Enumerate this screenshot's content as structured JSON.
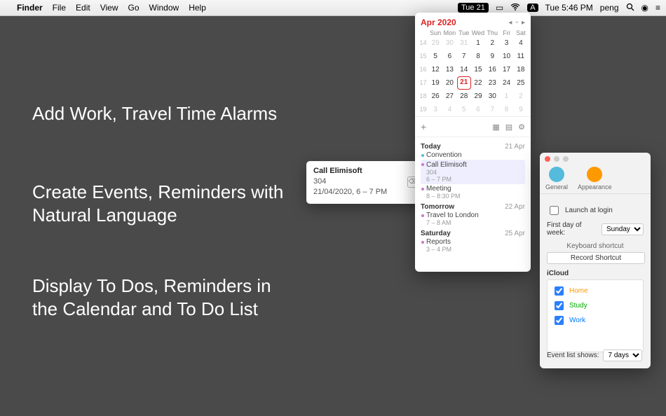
{
  "menubar": {
    "app": "Finder",
    "items": [
      "File",
      "Edit",
      "View",
      "Go",
      "Window",
      "Help"
    ],
    "date_badge": "Tue 21",
    "a_icon": "A",
    "clock": "Tue 5:46 PM",
    "user": "peng"
  },
  "marketing": {
    "l1": "Add Work, Travel Time Alarms",
    "l2": "Create Events, Reminders with Natural Language",
    "l3": "Display To Dos, Reminders in the Calendar and To Do List"
  },
  "quickadd": {
    "title": "Call Elimisoft",
    "room": "304",
    "when": "21/04/2020, 6 – 7 PM"
  },
  "cal": {
    "month": "Apr 2020",
    "wdays": [
      "Sun",
      "Mon",
      "Tue",
      "Wed",
      "Thu",
      "Fri",
      "Sat"
    ],
    "weeks": [
      {
        "wn": "14",
        "d": [
          "29",
          "30",
          "31",
          "1",
          "2",
          "3",
          "4"
        ],
        "dim": [
          0,
          1,
          2
        ]
      },
      {
        "wn": "15",
        "d": [
          "5",
          "6",
          "7",
          "8",
          "9",
          "10",
          "11"
        ],
        "dim": []
      },
      {
        "wn": "16",
        "d": [
          "12",
          "13",
          "14",
          "15",
          "16",
          "17",
          "18"
        ],
        "dim": []
      },
      {
        "wn": "17",
        "d": [
          "19",
          "20",
          "21",
          "22",
          "23",
          "24",
          "25"
        ],
        "dim": [],
        "today": 2
      },
      {
        "wn": "18",
        "d": [
          "26",
          "27",
          "28",
          "29",
          "30",
          "1",
          "2"
        ],
        "dim": [
          5,
          6
        ]
      },
      {
        "wn": "19",
        "d": [
          "3",
          "4",
          "5",
          "6",
          "7",
          "8",
          "9"
        ],
        "dim": [
          0,
          1,
          2,
          3,
          4,
          5,
          6
        ]
      }
    ],
    "agenda": [
      {
        "hdr": "Today",
        "date": "21 Apr",
        "events": [
          {
            "c": "b",
            "title": "Convention",
            "time": ""
          },
          {
            "c": "p",
            "title": "Call Elimisoft",
            "time": "",
            "sel": true,
            "sub": "304",
            "t2": "6 – 7 PM"
          },
          {
            "c": "p",
            "title": "Meeting",
            "time": "8 – 8:30 PM"
          }
        ]
      },
      {
        "hdr": "Tomorrow",
        "date": "22 Apr",
        "events": [
          {
            "c": "p",
            "title": "Travel to London",
            "time": "7 – 8 AM"
          }
        ]
      },
      {
        "hdr": "Saturday",
        "date": "25 Apr",
        "events": [
          {
            "c": "p",
            "title": "Reports",
            "time": "3 – 4 PM"
          }
        ]
      }
    ]
  },
  "prefs": {
    "tabs": {
      "general": "General",
      "appearance": "Appearance"
    },
    "launch": "Launch at login",
    "fdow_label": "First day of week:",
    "fdow_value": "Sunday",
    "shortcut_label": "Keyboard shortcut",
    "shortcut_btn": "Record Shortcut",
    "account": "iCloud",
    "cals": [
      {
        "name": "Home",
        "cls": "home"
      },
      {
        "name": "Study",
        "cls": "study"
      },
      {
        "name": "Work",
        "cls": "work"
      }
    ],
    "eventlist_label": "Event list shows:",
    "eventlist_value": "7 days"
  }
}
